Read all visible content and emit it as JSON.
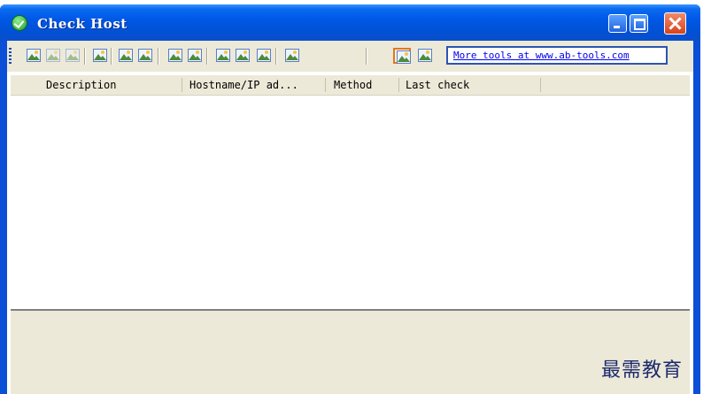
{
  "window": {
    "title": "Check Host"
  },
  "toolbar": {
    "link_text": "More tools at www.ab-tools.com",
    "tools": [
      {
        "name": "tool-1",
        "enabled": true
      },
      {
        "name": "tool-2",
        "enabled": false
      },
      {
        "name": "tool-3",
        "enabled": false
      },
      {
        "name": "tool-4",
        "enabled": true
      },
      {
        "name": "tool-5",
        "enabled": true
      },
      {
        "name": "tool-6",
        "enabled": true
      },
      {
        "name": "tool-7",
        "enabled": true
      },
      {
        "name": "tool-8",
        "enabled": true
      },
      {
        "name": "tool-9",
        "enabled": true
      },
      {
        "name": "tool-10",
        "enabled": true
      },
      {
        "name": "tool-11",
        "enabled": true
      },
      {
        "name": "tool-12",
        "enabled": true
      },
      {
        "name": "tool-13",
        "enabled": true,
        "pressed": true
      },
      {
        "name": "tool-14",
        "enabled": true
      }
    ]
  },
  "table": {
    "columns": [
      "Description",
      "Hostname/IP ad...",
      "Method",
      "Last check"
    ],
    "rows": []
  },
  "watermark": "最需教育"
}
